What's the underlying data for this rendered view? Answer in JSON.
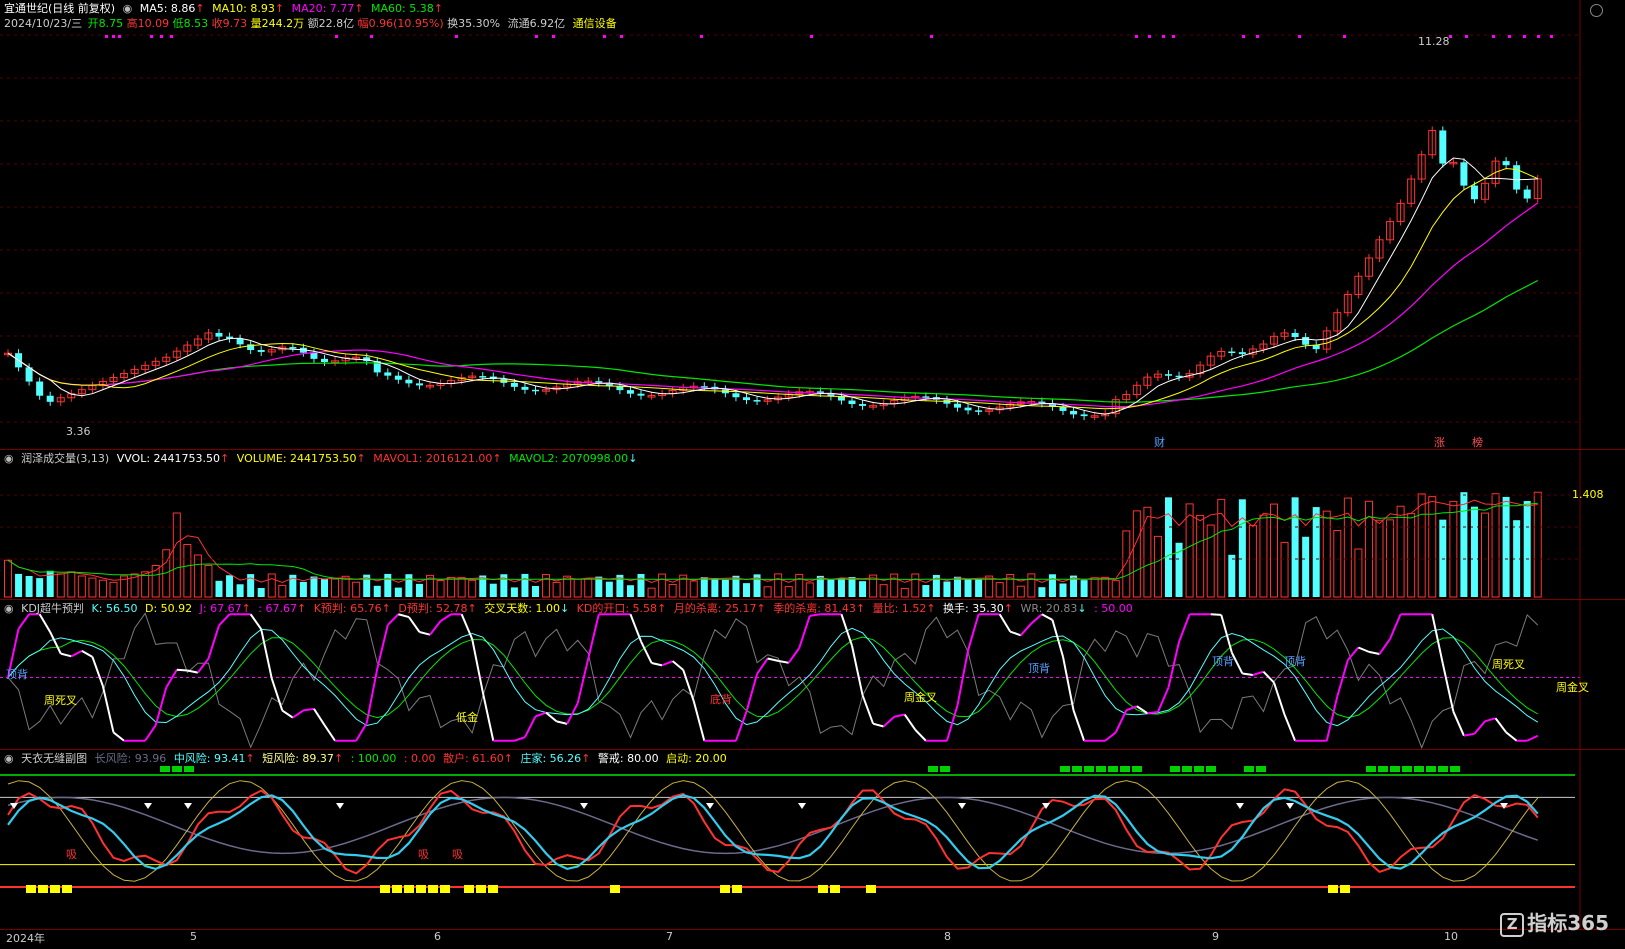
{
  "stock": {
    "title": "宜通世纪(日线 前复权)",
    "ma5": "MA5: 8.86",
    "ma10": "MA10: 8.93",
    "ma20": "MA20: 7.77",
    "ma60": "MA60: 5.38",
    "date": "2024/10/23/三",
    "open": "开8.75",
    "high": "高10.09",
    "low": "低8.53",
    "close": "收9.73",
    "vol": "量244.2万",
    "amount": "额22.8亿",
    "change": "幅0.96(10.95%)",
    "turnover": "换35.30%",
    "float": "流通6.92亿",
    "industry": "通信设备",
    "high_label": "11.28",
    "low_label": "3.36",
    "marks": [
      "财",
      "涨",
      "榜"
    ],
    "colors": {
      "up": "#ff3232",
      "down": "#54ffff",
      "ma5": "#ffffff",
      "ma10": "#ffff00",
      "ma20": "#ff00ff",
      "ma60": "#00e600"
    }
  },
  "volume": {
    "title": "润泽成交量(3,13)",
    "vvol": "VVOL: 2441753.50",
    "volume": "VOLUME: 2441753.50",
    "mavol1": "MAVOL1: 2016121.00",
    "mavol2": "MAVOL2: 2070998.00",
    "scale": "1.408"
  },
  "kdj": {
    "title": "KDJ超牛预判",
    "k": "K: 56.50",
    "d": "D: 50.92",
    "j": "J: 67.67",
    "j2": ": 67.67",
    "kpred": "K预判: 65.76",
    "dpred": "D预判: 52.78",
    "cross": "交叉天数: 1.00",
    "kdopen": "KD的开口: 5.58",
    "month": "月的杀离: 25.17",
    "season": "季的杀离: 81.43",
    "volratio": "量比: 1.52",
    "turnover": "换手: 35.30",
    "wr": "WR: 20.83",
    "fifty": ": 50.00",
    "tags": [
      "顶背",
      "周死叉",
      "低金",
      "底背",
      "周金叉",
      "顶背",
      "顶背",
      "顶背",
      "周死叉",
      "周金叉"
    ]
  },
  "tianyi": {
    "title": "天衣无缝副图",
    "long": "长风险: 93.96",
    "mid": "中风险: 93.41",
    "short": "短风险: 89.37",
    "v100": ": 100.00",
    "v0": ": 0.00",
    "retail": "散户: 61.60",
    "dealer": "庄家: 56.26",
    "warn": "警戒: 80.00",
    "start": "启动: 20.00",
    "tags": [
      "吸",
      "吸",
      "吸"
    ]
  },
  "xaxis": {
    "labels": [
      "2024年",
      "5",
      "6",
      "7",
      "8",
      "9",
      "10"
    ]
  },
  "logo": {
    "box": "Z",
    "text": "指标365"
  }
}
